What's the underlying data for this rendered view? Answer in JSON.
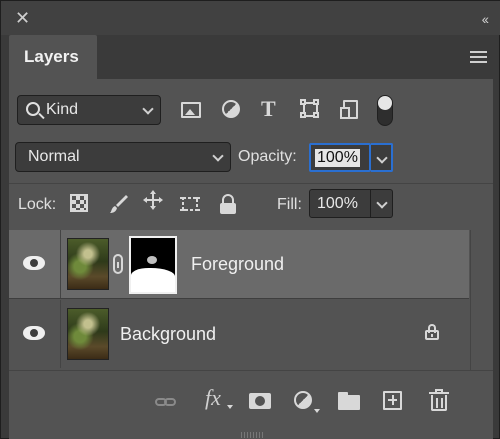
{
  "window": {
    "close_icon": "close-icon",
    "collapse_icon": "double-chevron-icon"
  },
  "tabs": [
    {
      "label": "Layers",
      "active": true
    }
  ],
  "filter": {
    "kind_label": "Kind",
    "icons": [
      "pixel-layer-filter-icon",
      "adjustment-layer-filter-icon",
      "type-layer-filter-icon",
      "shape-layer-filter-icon",
      "smart-object-filter-icon"
    ],
    "filter_enabled": true
  },
  "blend": {
    "mode": "Normal",
    "opacity_label": "Opacity:",
    "opacity_value": "100%"
  },
  "lock": {
    "label": "Lock:",
    "fill_label": "Fill:",
    "fill_value": "100%"
  },
  "layers": [
    {
      "name": "Foreground",
      "visible": true,
      "has_mask": true,
      "selected": true,
      "locked": false
    },
    {
      "name": "Background",
      "visible": true,
      "has_mask": false,
      "selected": false,
      "locked": true
    }
  ],
  "bottom_toolbar": {
    "fx_label": "fx",
    "icons": [
      "link-layers-icon",
      "layer-style-icon",
      "add-mask-icon",
      "new-adjustment-layer-icon",
      "new-group-icon",
      "new-layer-icon",
      "delete-layer-icon"
    ]
  },
  "colors": {
    "panel_bg": "#535353",
    "selected_row": "#6a6a6a",
    "focus_ring": "#2a6fd1"
  }
}
